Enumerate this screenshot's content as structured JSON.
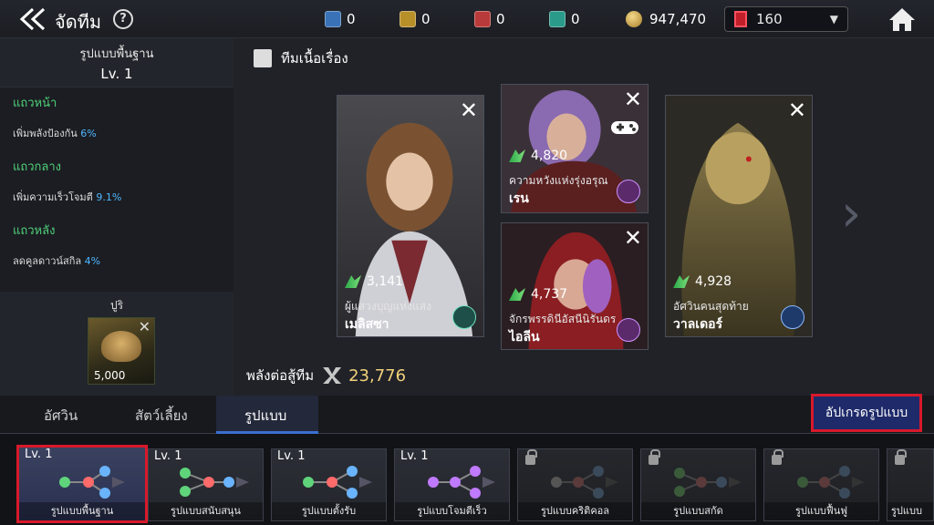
{
  "header": {
    "title": "จัดทีม",
    "help": "?",
    "currencies": [
      {
        "icon": "blue-gem-icon",
        "value": "0",
        "color": "#3a72b8"
      },
      {
        "icon": "gold-gem-icon",
        "value": "0",
        "color": "#b8902a"
      },
      {
        "icon": "red-gem-icon",
        "value": "0",
        "color": "#b83a3a"
      },
      {
        "icon": "teal-gem-icon",
        "value": "0",
        "color": "#2a9a8a"
      }
    ],
    "gold": "947,470",
    "ticket": "160"
  },
  "left": {
    "formation_name": "รูปแบบพื้นฐาน",
    "formation_level": "Lv. 1",
    "rows": [
      {
        "title": "แถวหน้า",
        "desc": "เพิ่มพลังป้องกัน",
        "value": "6%"
      },
      {
        "title": "แถวกลาง",
        "desc": "เพิ่มความเร็วโจมตี",
        "value": "9.1%"
      },
      {
        "title": "แถวหลัง",
        "desc": "ลดคูลดาวน์สกิล",
        "value": "4%"
      }
    ],
    "pet_label": "ปูริ",
    "pet_power": "5,000"
  },
  "main": {
    "story_team": "ทีมเนื้อเรื่อง",
    "heroes": [
      {
        "power": "3,141",
        "subtitle": "ผู้แสวงบุญแห่งแสง",
        "name": "เมลิสซา"
      },
      {
        "power": "4,820",
        "subtitle": "ความหวังแห่งรุ่งอรุณ",
        "name": "เรน"
      },
      {
        "power": "4,737",
        "subtitle": "จักรพรรดินีอัสนีนิรันดร",
        "name": "ไอลีน"
      },
      {
        "power": "4,928",
        "subtitle": "อัศวินคนสุดท้าย",
        "name": "วาลเดอร์"
      }
    ],
    "team_power_label": "พลังต่อสู้ทีม",
    "team_power": "23,776"
  },
  "tabs": {
    "knight": "อัศวิน",
    "pet": "สัตว์เลี้ยง",
    "formation": "รูปแบบ",
    "upgrade": "อัปเกรดรูปแบบ"
  },
  "formations": [
    {
      "level": "Lv. 1",
      "name": "รูปแบบพื้นฐาน",
      "locked": false,
      "selected": true,
      "colors": [
        "#5fd47a",
        "#ff6a6a",
        "#6ab4ff"
      ]
    },
    {
      "level": "Lv. 1",
      "name": "รูปแบบสนับสนุน",
      "locked": false,
      "selected": false,
      "colors": [
        "#5fd47a",
        "#ff6a6a",
        "#6ab4ff"
      ]
    },
    {
      "level": "Lv. 1",
      "name": "รูปแบบตั้งรับ",
      "locked": false,
      "selected": false,
      "colors": [
        "#5fd47a",
        "#ff6a6a",
        "#6ab4ff"
      ]
    },
    {
      "level": "Lv. 1",
      "name": "รูปแบบโจมตีเร็ว",
      "locked": false,
      "selected": false,
      "colors": [
        "#c07aff",
        "#c07aff",
        "#c07aff"
      ]
    },
    {
      "level": "",
      "name": "รูปแบบคริติคอล",
      "locked": true,
      "selected": false,
      "colors": [
        "#555",
        "#555",
        "#555"
      ]
    },
    {
      "level": "",
      "name": "รูปแบบสกัด",
      "locked": true,
      "selected": false,
      "colors": [
        "#555",
        "#555",
        "#555"
      ]
    },
    {
      "level": "",
      "name": "รูปแบบฟื้นฟู",
      "locked": true,
      "selected": false,
      "colors": [
        "#555",
        "#555",
        "#555"
      ]
    },
    {
      "level": "",
      "name": "รูปแบบ",
      "locked": true,
      "selected": false,
      "colors": [
        "#555",
        "#555",
        "#555"
      ]
    }
  ]
}
